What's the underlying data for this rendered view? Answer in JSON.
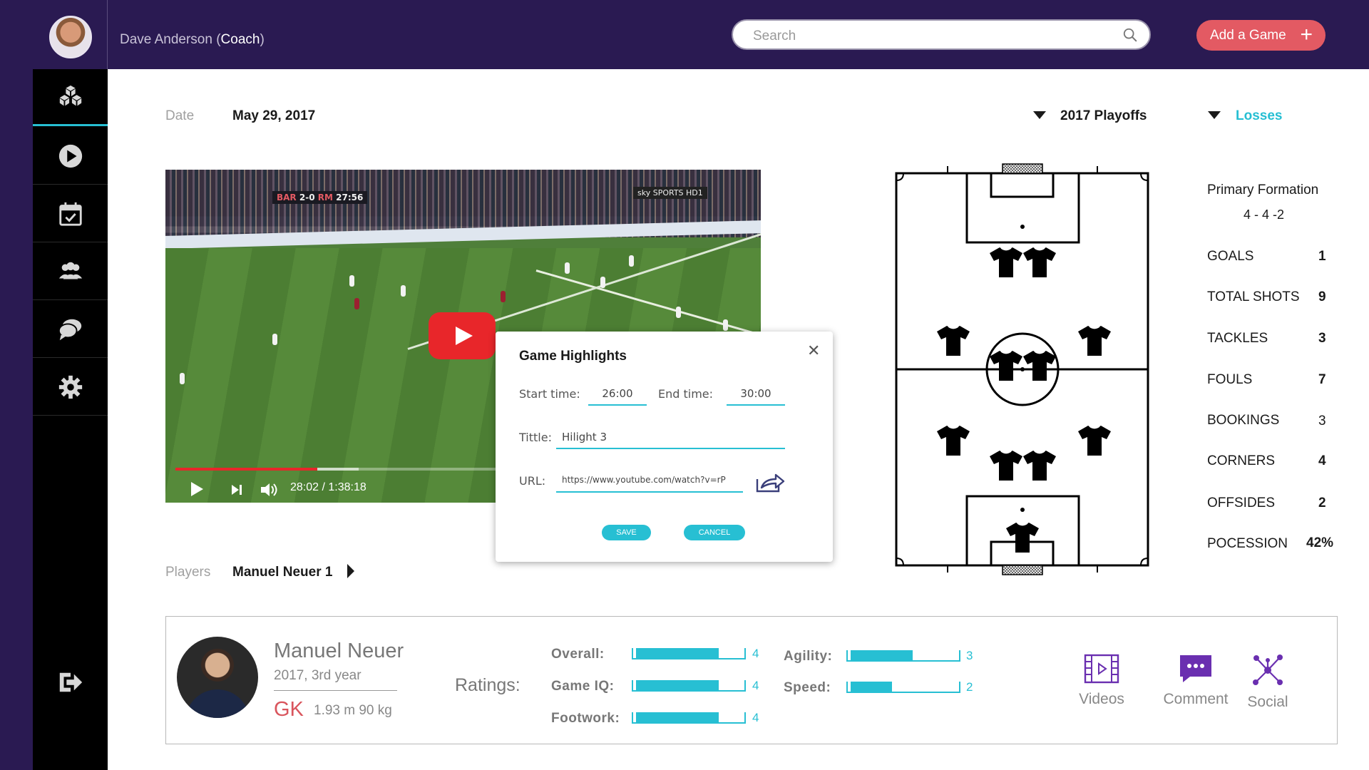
{
  "header": {
    "coach_name": "Dave Anderson",
    "coach_role": "Coach",
    "search_placeholder": "Search",
    "add_game_label": "Add a Game"
  },
  "sidebar": {
    "items": [
      {
        "name": "dashboard-icon"
      },
      {
        "name": "play-icon"
      },
      {
        "name": "calendar-check-icon"
      },
      {
        "name": "team-icon"
      },
      {
        "name": "chat-icon"
      },
      {
        "name": "gear-icon"
      }
    ],
    "logout_icon": "logout-icon"
  },
  "filters": {
    "date_label": "Date",
    "date_value": "May 29, 2017",
    "season": "2017 Playoffs",
    "result": "Losses"
  },
  "video": {
    "score_home": "BAR",
    "score": "2-0",
    "score_away": "RM",
    "clock": "27:56",
    "channel": "sky SPORTS HD1",
    "time_display": "28:02 / 1:38:18",
    "progress_played": 0.246,
    "progress_loaded": 0.318
  },
  "modal": {
    "title": "Game Highlights",
    "start_label": "Start time:",
    "start_value": "26:00",
    "end_label": "End time:",
    "end_value": "30:00",
    "title_label": "Tittle:",
    "title_value": "Hilight 3",
    "url_label": "URL:",
    "url_value": "https://www.youtube.com/watch?v=rP",
    "save_label": "SAVE",
    "cancel_label": "CANCEL",
    "close_glyph": "✕"
  },
  "players": {
    "label": "Players",
    "value": "Manuel Neuer 1"
  },
  "stats": {
    "formation_label": "Primary Formation",
    "formation_value": "4 - 4 -2",
    "rows": [
      {
        "label": "GOALS",
        "value": "1"
      },
      {
        "label": "TOTAL SHOTS",
        "value": "9"
      },
      {
        "label": "TACKLES",
        "value": "3"
      },
      {
        "label": "FOULS",
        "value": "7"
      },
      {
        "label": "BOOKINGS",
        "value": "3"
      },
      {
        "label": "CORNERS",
        "value": "4"
      },
      {
        "label": "OFFSIDES",
        "value": "2"
      },
      {
        "label": "POCESSION",
        "value": "42%"
      }
    ]
  },
  "player_card": {
    "name": "Manuel Neuer",
    "year": "2017, 3rd year",
    "position": "GK",
    "bio": "1.93 m 90 kg",
    "ratings_title": "Ratings:",
    "ratings": [
      {
        "label": "Overall:",
        "value": 4,
        "max": 5
      },
      {
        "label": "Game IQ:",
        "value": 4,
        "max": 5
      },
      {
        "label": "Footwork:",
        "value": 4,
        "max": 5
      },
      {
        "label": "Agility:",
        "value": 3,
        "max": 5
      },
      {
        "label": "Speed:",
        "value": 2,
        "max": 5
      }
    ],
    "actions": [
      {
        "label": "Videos",
        "icon": "film-icon"
      },
      {
        "label": "Comment",
        "icon": "comment-icon"
      },
      {
        "label": "Social",
        "icon": "network-icon"
      }
    ]
  },
  "colors": {
    "header_bg": "#2a1a52",
    "accent": "#27bfd3",
    "add_button": "#e35a63",
    "position_red": "#d9555d",
    "icon_purple": "#6a2fb0"
  }
}
